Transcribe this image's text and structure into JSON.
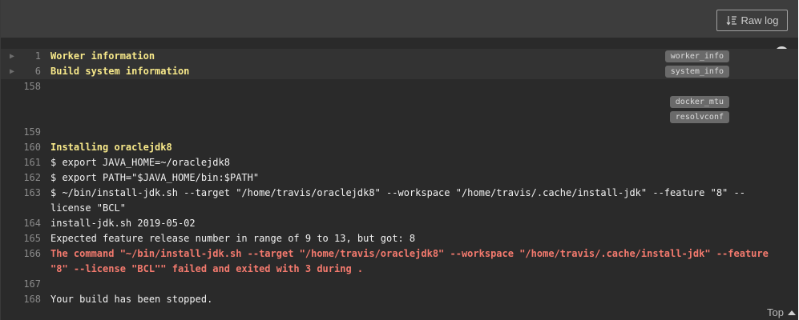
{
  "toolbar": {
    "raw_log_label": "Raw log",
    "raw_log_icon": "sort-lines-icon"
  },
  "status": {
    "icon": "running-circle-icon"
  },
  "lines": {
    "l1": {
      "num": "1",
      "text": "Worker information",
      "tag": "worker_info"
    },
    "l6": {
      "num": "6",
      "text": "Build system information",
      "tag": "system_info"
    },
    "l158": {
      "num": "158",
      "text": "",
      "tag_a": "docker_mtu",
      "tag_b": "resolvconf"
    },
    "l159": {
      "num": "159",
      "text": ""
    },
    "l160": {
      "num": "160",
      "text": "Installing oraclejdk8"
    },
    "l161": {
      "num": "161",
      "text": "$ export JAVA_HOME=~/oraclejdk8"
    },
    "l162": {
      "num": "162",
      "text": "$ export PATH=\"$JAVA_HOME/bin:$PATH\""
    },
    "l163": {
      "num": "163",
      "text": "$ ~/bin/install-jdk.sh --target \"/home/travis/oraclejdk8\" --workspace \"/home/travis/.cache/install-jdk\" --feature \"8\" --license \"BCL\""
    },
    "l164": {
      "num": "164",
      "text": "install-jdk.sh 2019-05-02"
    },
    "l165": {
      "num": "165",
      "text": "Expected feature release number in range of 9 to 13, but got: 8"
    },
    "l166": {
      "num": "166",
      "text": "The command \"~/bin/install-jdk.sh --target \"/home/travis/oraclejdk8\" --workspace \"/home/travis/.cache/install-jdk\" --feature \"8\" --license \"BCL\"\" failed and exited with 3 during ."
    },
    "l167": {
      "num": "167",
      "text": ""
    },
    "l168": {
      "num": "168",
      "text": "Your build has been stopped."
    }
  },
  "footer": {
    "top_label": "Top"
  },
  "colors": {
    "background": "#2a2a2a",
    "toolbar": "#3d3d3d",
    "section_header": "#f8e98a",
    "error": "#f47a6e",
    "tag_bg": "#6a6a6a"
  }
}
